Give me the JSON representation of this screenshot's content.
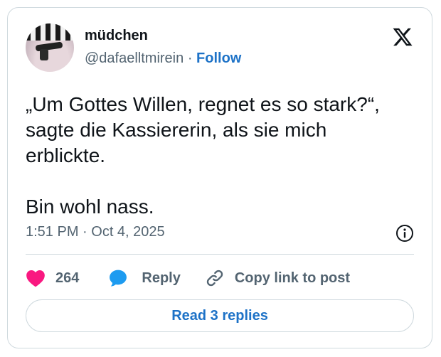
{
  "author": {
    "display_name": "müdchen",
    "handle": "@dafaelltmirein",
    "separator": "·",
    "follow_label": "Follow"
  },
  "tweet": {
    "text": "„Um Gottes Willen, regnet es so stark?“,\nsagte die Kassiererin, als sie mich\nerblickte.\n\nBin wohl nass.",
    "timestamp": "1:51 PM · Oct 4, 2025"
  },
  "actions": {
    "like_count": "264",
    "reply_label": "Reply",
    "copy_link_label": "Copy link to post"
  },
  "read_replies_label": "Read 3 replies",
  "icons": {
    "logo": "x-logo-icon",
    "info": "info-icon",
    "like": "heart-icon",
    "reply": "speech-bubble-icon",
    "copy": "link-icon"
  },
  "colors": {
    "link": "#1d72c7",
    "heart": "#f91880",
    "reply_bubble": "#1d9bf0",
    "muted": "#536471",
    "border": "#cfd9de"
  }
}
